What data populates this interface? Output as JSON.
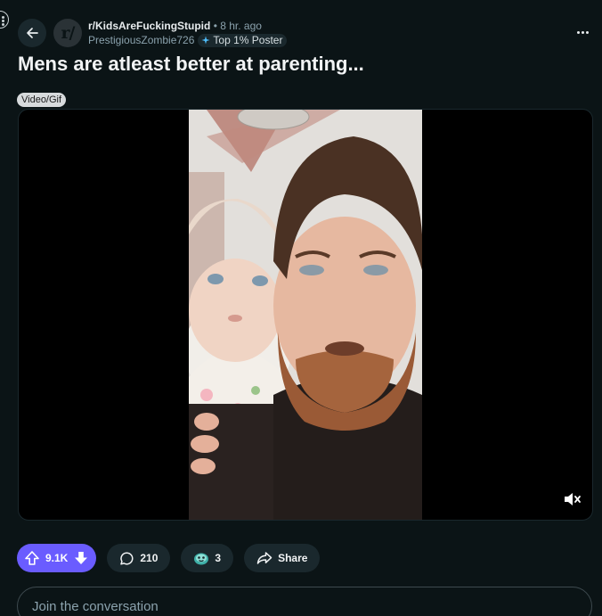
{
  "post": {
    "subreddit": "r/KidsAreFuckingStupid",
    "separator": "•",
    "time": "8 hr. ago",
    "author": "PrestigiousZombie726",
    "author_flair": "Top 1% Poster",
    "subreddit_avatar_text": "r/",
    "title": "Mens are atleast better at parenting...",
    "flair_tag": "Video/Gif"
  },
  "actions": {
    "upvotes": "9.1K",
    "comments": "210",
    "awards": "3",
    "share_label": "Share"
  },
  "comment_box": {
    "placeholder": "Join the conversation"
  },
  "colors": {
    "background": "#0b1416",
    "upvote_accent": "#6a5cff",
    "pill_bg": "#1a282d"
  },
  "icons": [
    "back-arrow-icon",
    "more-options-icon",
    "upvote-icon",
    "downvote-icon",
    "comment-icon",
    "award-icon",
    "share-icon",
    "mute-icon"
  ]
}
